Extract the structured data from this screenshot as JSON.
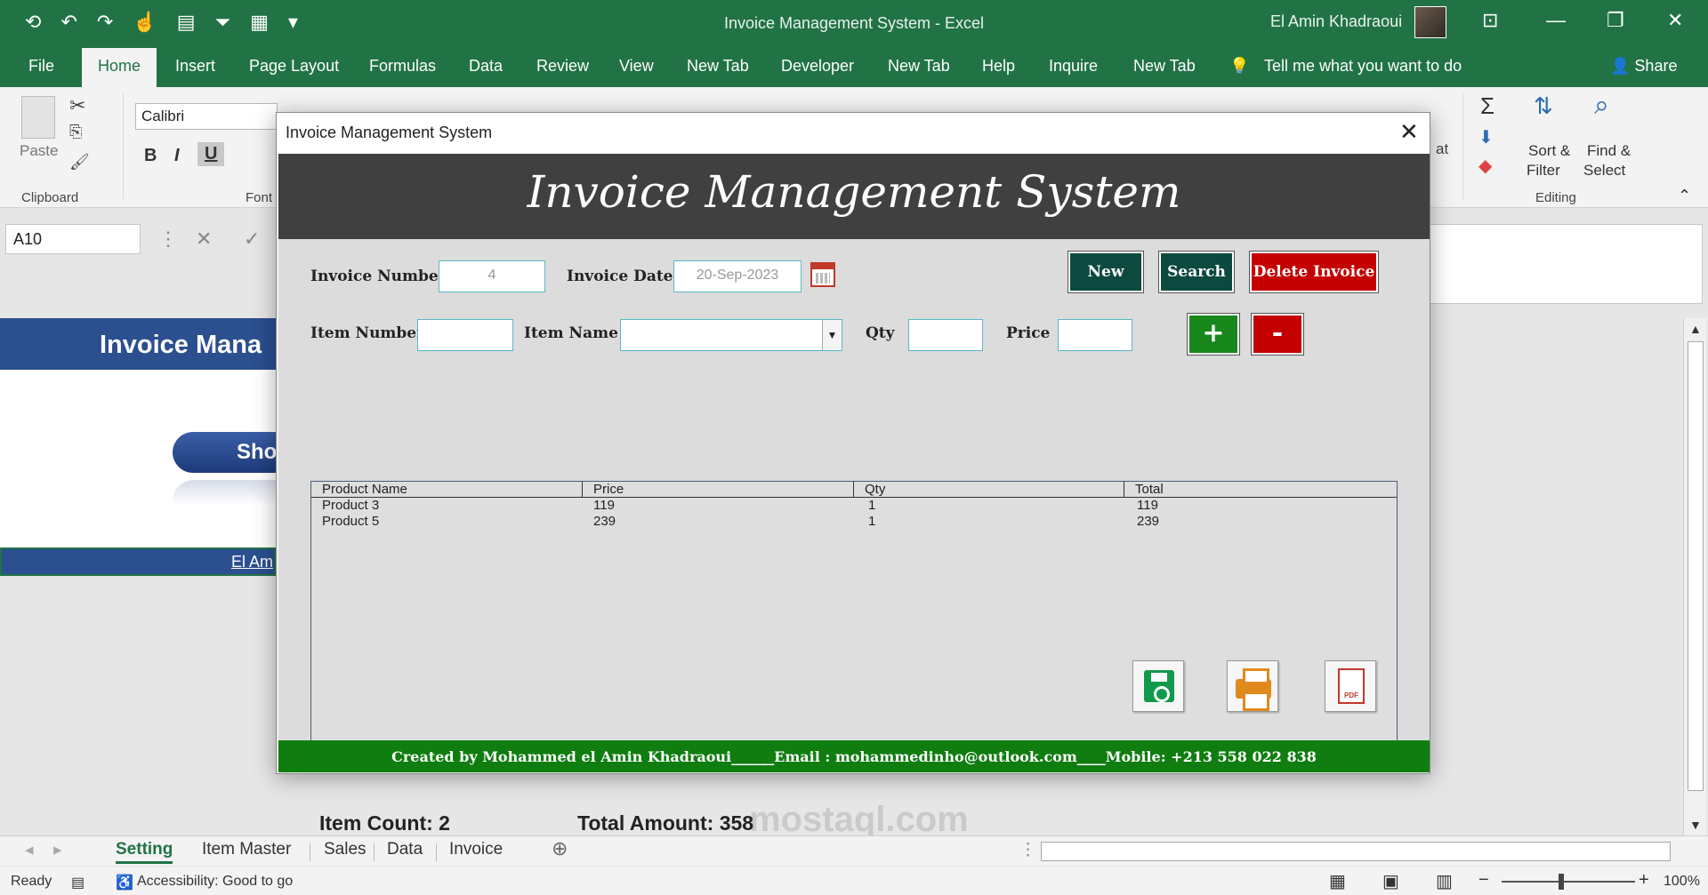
{
  "window": {
    "title": "Invoice Management System  -  Excel",
    "user_name": "El Amin Khadraoui",
    "share_label": "Share",
    "tell_me": "Tell me what you want to do"
  },
  "ribbon_tabs": [
    "File",
    "Home",
    "Insert",
    "Page Layout",
    "Formulas",
    "Data",
    "Review",
    "View",
    "New Tab",
    "Developer",
    "New Tab",
    "Help",
    "Inquire",
    "New Tab"
  ],
  "ribbon": {
    "paste_label": "Paste",
    "clipboard_label": "Clipboard",
    "font_group_label": "Font",
    "font_name": "Calibri",
    "bold": "B",
    "italic": "I",
    "underline": "U",
    "sort_label": "Sort &",
    "filter_label": "Filter",
    "find_label": "Find &",
    "select_label": "Select",
    "editing_label": "Editing",
    "partial_format": "at"
  },
  "formula_bar": {
    "name_box": "A10"
  },
  "sheet": {
    "header_partial": "Invoice Mana",
    "show_button_partial": "Sho",
    "name_partial": "El Am"
  },
  "sheet_tabs": [
    "Setting",
    "Item Master",
    "Sales",
    "Data",
    "Invoice"
  ],
  "status": {
    "ready": "Ready",
    "accessibility": "Accessibility: Good to go",
    "zoom": "100%"
  },
  "watermark": "mostaql.com",
  "dialog": {
    "title": "Invoice Management System",
    "banner": "Invoice Management System",
    "invoice_number_label": "Invoice Number",
    "invoice_number": "4",
    "invoice_date_label": "Invoice Date",
    "invoice_date": "20-Sep-2023",
    "new_label": "New",
    "search_label": "Search",
    "delete_label": "Delete Invoice",
    "item_number_label": "Item Number",
    "item_name_label": "Item Name",
    "qty_label": "Qty",
    "price_label": "Price",
    "add_label": "+",
    "remove_label": "-",
    "columns": [
      "Product Name",
      "Price",
      "Qty",
      "Total"
    ],
    "rows": [
      [
        "Product 3",
        "119",
        "1",
        "119"
      ],
      [
        "Product 5",
        "239",
        "1",
        "239"
      ]
    ],
    "item_count_label": "Item Count:",
    "item_count": "2",
    "total_amount_label": "Total Amount:",
    "total_amount": "358",
    "pdf_glyph": "PDF",
    "footer": "Created by Mohammed el Amin Khadraoui______Email : mohammedinho@outlook.com____Mobile: +213 558 022 838"
  }
}
